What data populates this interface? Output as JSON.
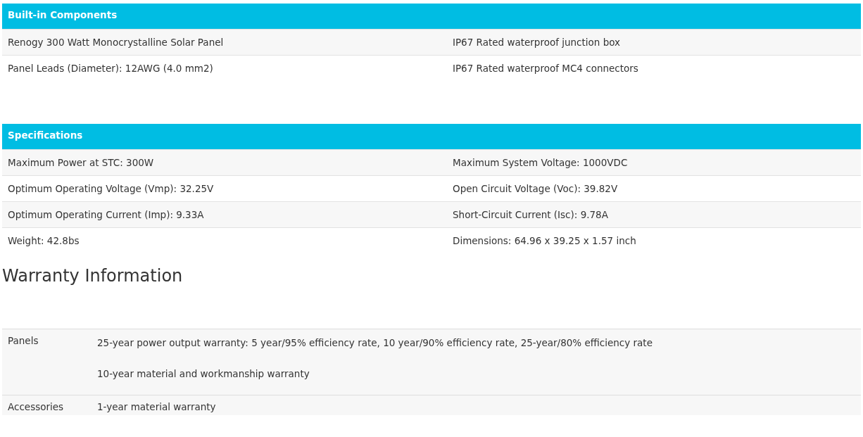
{
  "built_in": {
    "title": "Built-in Components",
    "rows": [
      [
        "Renogy 300 Watt Monocrystalline Solar Panel",
        "IP67 Rated waterproof junction box"
      ],
      [
        "Panel Leads (Diameter): 12AWG (4.0 mm2)",
        "IP67 Rated waterproof MC4 connectors"
      ]
    ]
  },
  "specifications": {
    "title": "Specifications",
    "rows": [
      [
        "Maximum Power at STC: 300W",
        "Maximum System Voltage: 1000VDC"
      ],
      [
        "Optimum Operating Voltage (Vmp): 32.25V",
        "Open Circuit Voltage (Voc): 39.82V"
      ],
      [
        "Optimum Operating Current (Imp): 9.33A",
        "Short-Circuit Current (Isc): 9.78A"
      ],
      [
        "Weight: 42.8bs",
        "Dimensions: 64.96 x 39.25 x 1.57 inch"
      ]
    ]
  },
  "warranty": {
    "title": "Warranty Information",
    "rows": [
      {
        "label": "Panels",
        "lines": [
          "25-year power output warranty: 5 year/95% efficiency rate, 10 year/90% efficiency rate, 25-year/80% efficiency rate",
          "10-year material and workmanship warranty"
        ]
      },
      {
        "label": "Accessories",
        "lines": [
          "1-year material warranty"
        ]
      }
    ]
  }
}
